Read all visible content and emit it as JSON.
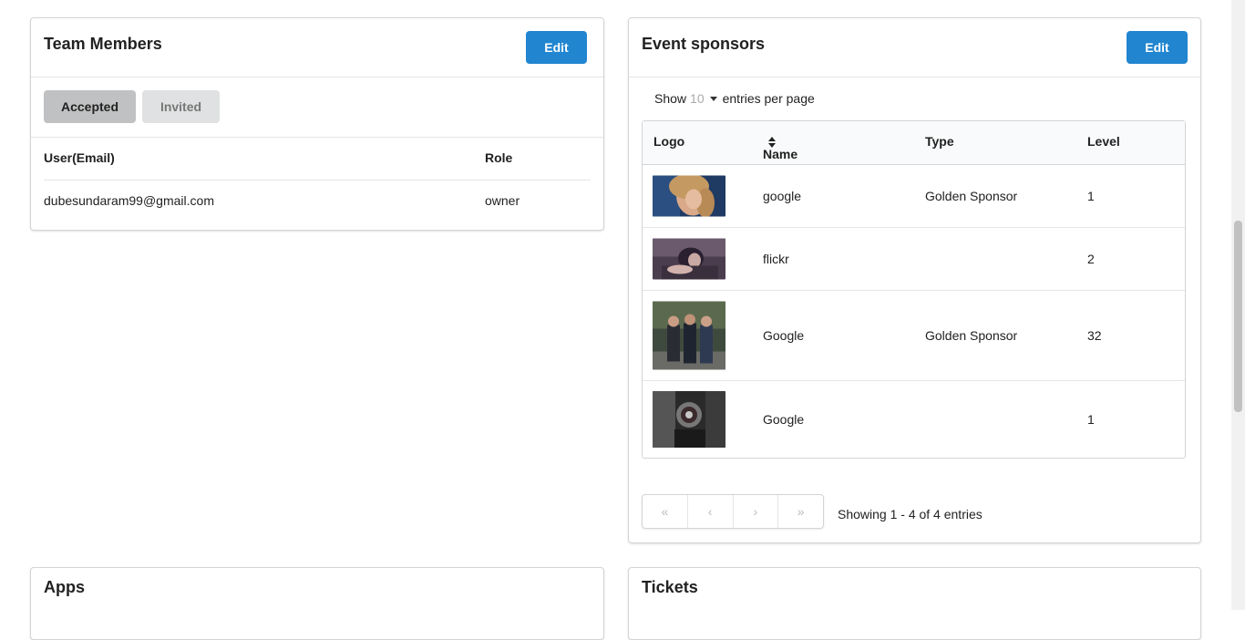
{
  "team": {
    "title": "Team Members",
    "edit_label": "Edit",
    "tabs": [
      {
        "label": "Accepted",
        "active": true
      },
      {
        "label": "Invited",
        "active": false
      }
    ],
    "columns": [
      "User(Email)",
      "Role"
    ],
    "rows": [
      {
        "email": "dubesundaram99@gmail.com",
        "role": "owner"
      }
    ]
  },
  "sponsors": {
    "title": "Event sponsors",
    "edit_label": "Edit",
    "show_prefix": "Show",
    "show_count": "10",
    "show_suffix": "entries per page",
    "columns": [
      "Logo",
      "Name",
      "Type",
      "Level"
    ],
    "rows": [
      {
        "name": "google",
        "type": "Golden Sponsor",
        "level": "1"
      },
      {
        "name": "flickr",
        "type": "",
        "level": "2"
      },
      {
        "name": "Google",
        "type": "Golden Sponsor",
        "level": "32"
      },
      {
        "name": "Google",
        "type": "",
        "level": "1"
      }
    ],
    "pager": [
      "«",
      "‹",
      "›",
      "»"
    ],
    "showing": "Showing 1 - 4 of 4 entries"
  },
  "apps": {
    "title": "Apps"
  },
  "tickets": {
    "title": "Tickets"
  },
  "colors": {
    "primary": "#2185d0"
  }
}
